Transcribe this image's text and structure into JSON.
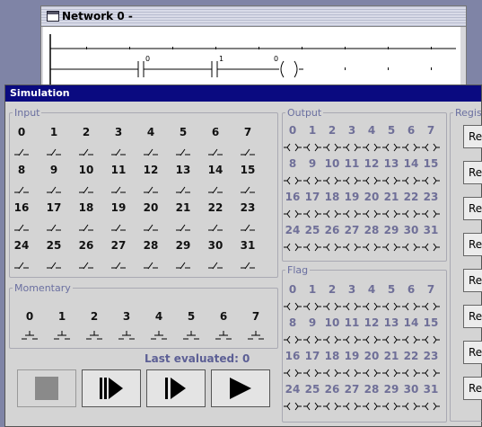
{
  "network": {
    "title": "Network 0 -",
    "contact_a": "0",
    "contact_b": "1",
    "coil": "0"
  },
  "simulation": {
    "title": "Simulation",
    "input": {
      "legend": "Input",
      "rows": [
        [
          "0",
          "1",
          "2",
          "3",
          "4",
          "5",
          "6",
          "7"
        ],
        [
          "8",
          "9",
          "10",
          "11",
          "12",
          "13",
          "14",
          "15"
        ],
        [
          "16",
          "17",
          "18",
          "19",
          "20",
          "21",
          "22",
          "23"
        ],
        [
          "24",
          "25",
          "26",
          "27",
          "28",
          "29",
          "30",
          "31"
        ]
      ]
    },
    "output": {
      "legend": "Output",
      "rows": [
        [
          "0",
          "1",
          "2",
          "3",
          "4",
          "5",
          "6",
          "7"
        ],
        [
          "8",
          "9",
          "10",
          "11",
          "12",
          "13",
          "14",
          "15"
        ],
        [
          "16",
          "17",
          "18",
          "19",
          "20",
          "21",
          "22",
          "23"
        ],
        [
          "24",
          "25",
          "26",
          "27",
          "28",
          "29",
          "30",
          "31"
        ]
      ]
    },
    "flag": {
      "legend": "Flag",
      "rows": [
        [
          "0",
          "1",
          "2",
          "3",
          "4",
          "5",
          "6",
          "7"
        ],
        [
          "8",
          "9",
          "10",
          "11",
          "12",
          "13",
          "14",
          "15"
        ],
        [
          "16",
          "17",
          "18",
          "19",
          "20",
          "21",
          "22",
          "23"
        ],
        [
          "24",
          "25",
          "26",
          "27",
          "28",
          "29",
          "30",
          "31"
        ]
      ]
    },
    "momentary": {
      "legend": "Momentary",
      "labels": [
        "0",
        "1",
        "2",
        "3",
        "4",
        "5",
        "6",
        "7"
      ]
    },
    "last_evaluated": "Last evaluated: 0",
    "register": {
      "legend": "Regis",
      "buttons": [
        "Reg",
        "Reg",
        "Reg",
        "Reg",
        "Reg",
        "Reg",
        "Reg",
        "Reg"
      ]
    }
  }
}
